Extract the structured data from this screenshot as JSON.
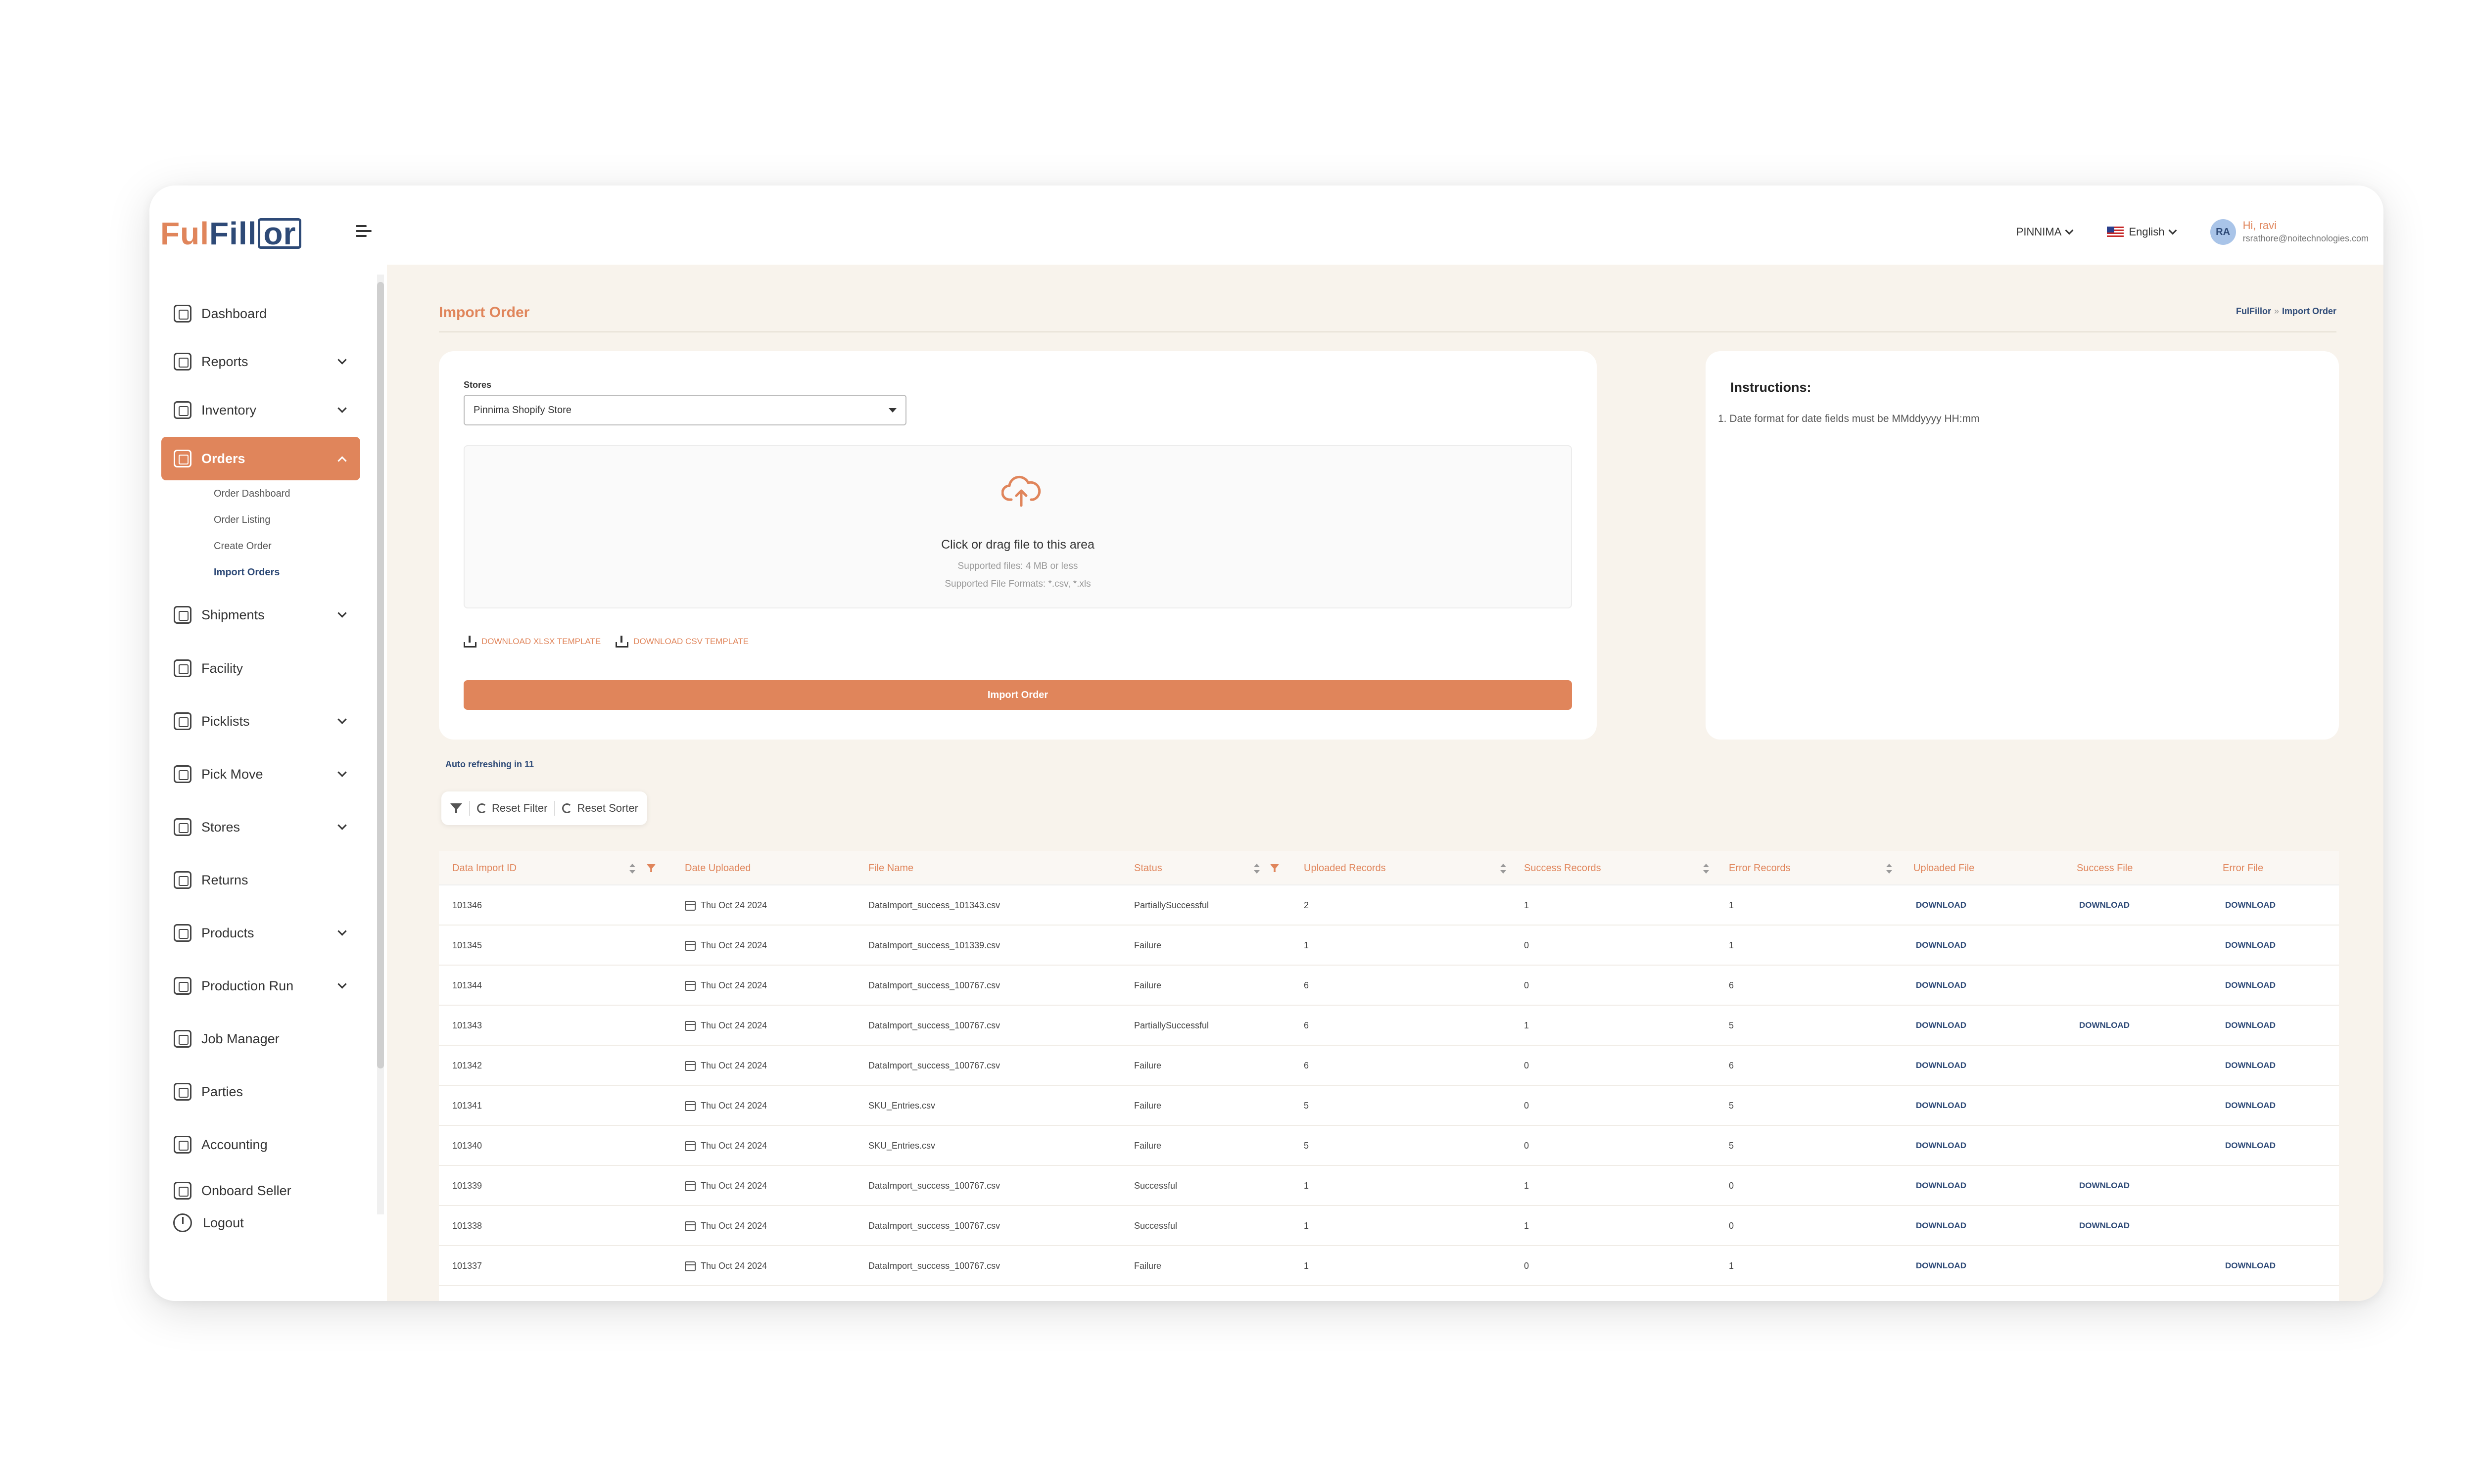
{
  "header": {
    "logo": {
      "part1": "Ful",
      "part2": "Fill",
      "part3": "or"
    },
    "store_selector": "PINNIMA",
    "language": "English",
    "user": {
      "initials": "RA",
      "greeting": "Hi, ravi",
      "email": "rsrathore@noitechnologies.com"
    }
  },
  "sidebar": {
    "items": [
      {
        "label": "Dashboard"
      },
      {
        "label": "Reports"
      },
      {
        "label": "Inventory"
      },
      {
        "label": "Orders"
      },
      {
        "label": "Shipments"
      },
      {
        "label": "Facility"
      },
      {
        "label": "Picklists"
      },
      {
        "label": "Pick Move"
      },
      {
        "label": "Stores"
      },
      {
        "label": "Returns"
      },
      {
        "label": "Products"
      },
      {
        "label": "Production Run"
      },
      {
        "label": "Job Manager"
      },
      {
        "label": "Parties"
      },
      {
        "label": "Accounting"
      },
      {
        "label": "Onboard Seller"
      }
    ],
    "order_subitems": [
      "Order Dashboard",
      "Order Listing",
      "Create Order",
      "Import Orders"
    ],
    "logout": "Logout"
  },
  "page": {
    "title": "Import Order",
    "breadcrumb": {
      "root": "FulFillor",
      "separator": "»",
      "current": "Import Order"
    }
  },
  "import_form": {
    "stores_label": "Stores",
    "stores_value": "Pinnima Shopify Store",
    "dropzone_title": "Click or drag file to this area",
    "dropzone_size": "Supported files: 4 MB or less",
    "dropzone_formats": "Supported File Formats: *.csv, *.xls",
    "download_xlsx": "DOWNLOAD XLSX TEMPLATE",
    "download_csv": "DOWNLOAD CSV TEMPLATE",
    "import_button": "Import Order"
  },
  "instructions": {
    "title": "Instructions:",
    "items": [
      "1. Date format for date fields must be MMddyyyy HH:mm"
    ]
  },
  "auto_refresh": "Auto refreshing in 11",
  "filter_bar": {
    "reset_filter": "Reset Filter",
    "reset_sorter": "Reset Sorter"
  },
  "table": {
    "columns": [
      "Data Import ID",
      "Date Uploaded",
      "File Name",
      "Status",
      "Uploaded Records",
      "Success Records",
      "Error Records",
      "Uploaded File",
      "Success File",
      "Error File"
    ],
    "rows": [
      {
        "id": "101346",
        "date": "Thu Oct 24 2024",
        "file": "DataImport_success_101343.csv",
        "status": "PartiallySuccessful",
        "uploaded": "2",
        "success": "1",
        "error": "1",
        "up_file": "DOWNLOAD",
        "succ_file": "DOWNLOAD",
        "err_file": "DOWNLOAD"
      },
      {
        "id": "101345",
        "date": "Thu Oct 24 2024",
        "file": "DataImport_success_101339.csv",
        "status": "Failure",
        "uploaded": "1",
        "success": "0",
        "error": "1",
        "up_file": "DOWNLOAD",
        "succ_file": "",
        "err_file": "DOWNLOAD"
      },
      {
        "id": "101344",
        "date": "Thu Oct 24 2024",
        "file": "DataImport_success_100767.csv",
        "status": "Failure",
        "uploaded": "6",
        "success": "0",
        "error": "6",
        "up_file": "DOWNLOAD",
        "succ_file": "",
        "err_file": "DOWNLOAD"
      },
      {
        "id": "101343",
        "date": "Thu Oct 24 2024",
        "file": "DataImport_success_100767.csv",
        "status": "PartiallySuccessful",
        "uploaded": "6",
        "success": "1",
        "error": "5",
        "up_file": "DOWNLOAD",
        "succ_file": "DOWNLOAD",
        "err_file": "DOWNLOAD"
      },
      {
        "id": "101342",
        "date": "Thu Oct 24 2024",
        "file": "DataImport_success_100767.csv",
        "status": "Failure",
        "uploaded": "6",
        "success": "0",
        "error": "6",
        "up_file": "DOWNLOAD",
        "succ_file": "",
        "err_file": "DOWNLOAD"
      },
      {
        "id": "101341",
        "date": "Thu Oct 24 2024",
        "file": "SKU_Entries.csv",
        "status": "Failure",
        "uploaded": "5",
        "success": "0",
        "error": "5",
        "up_file": "DOWNLOAD",
        "succ_file": "",
        "err_file": "DOWNLOAD"
      },
      {
        "id": "101340",
        "date": "Thu Oct 24 2024",
        "file": "SKU_Entries.csv",
        "status": "Failure",
        "uploaded": "5",
        "success": "0",
        "error": "5",
        "up_file": "DOWNLOAD",
        "succ_file": "",
        "err_file": "DOWNLOAD"
      },
      {
        "id": "101339",
        "date": "Thu Oct 24 2024",
        "file": "DataImport_success_100767.csv",
        "status": "Successful",
        "uploaded": "1",
        "success": "1",
        "error": "0",
        "up_file": "DOWNLOAD",
        "succ_file": "DOWNLOAD",
        "err_file": ""
      },
      {
        "id": "101338",
        "date": "Thu Oct 24 2024",
        "file": "DataImport_success_100767.csv",
        "status": "Successful",
        "uploaded": "1",
        "success": "1",
        "error": "0",
        "up_file": "DOWNLOAD",
        "succ_file": "DOWNLOAD",
        "err_file": ""
      },
      {
        "id": "101337",
        "date": "Thu Oct 24 2024",
        "file": "DataImport_success_100767.csv",
        "status": "Failure",
        "uploaded": "1",
        "success": "0",
        "error": "1",
        "up_file": "DOWNLOAD",
        "succ_file": "",
        "err_file": "DOWNLOAD"
      }
    ]
  },
  "colors": {
    "accent": "#e0855b",
    "brand_navy": "#2e4a77",
    "main_bg": "#f8f3ec"
  }
}
